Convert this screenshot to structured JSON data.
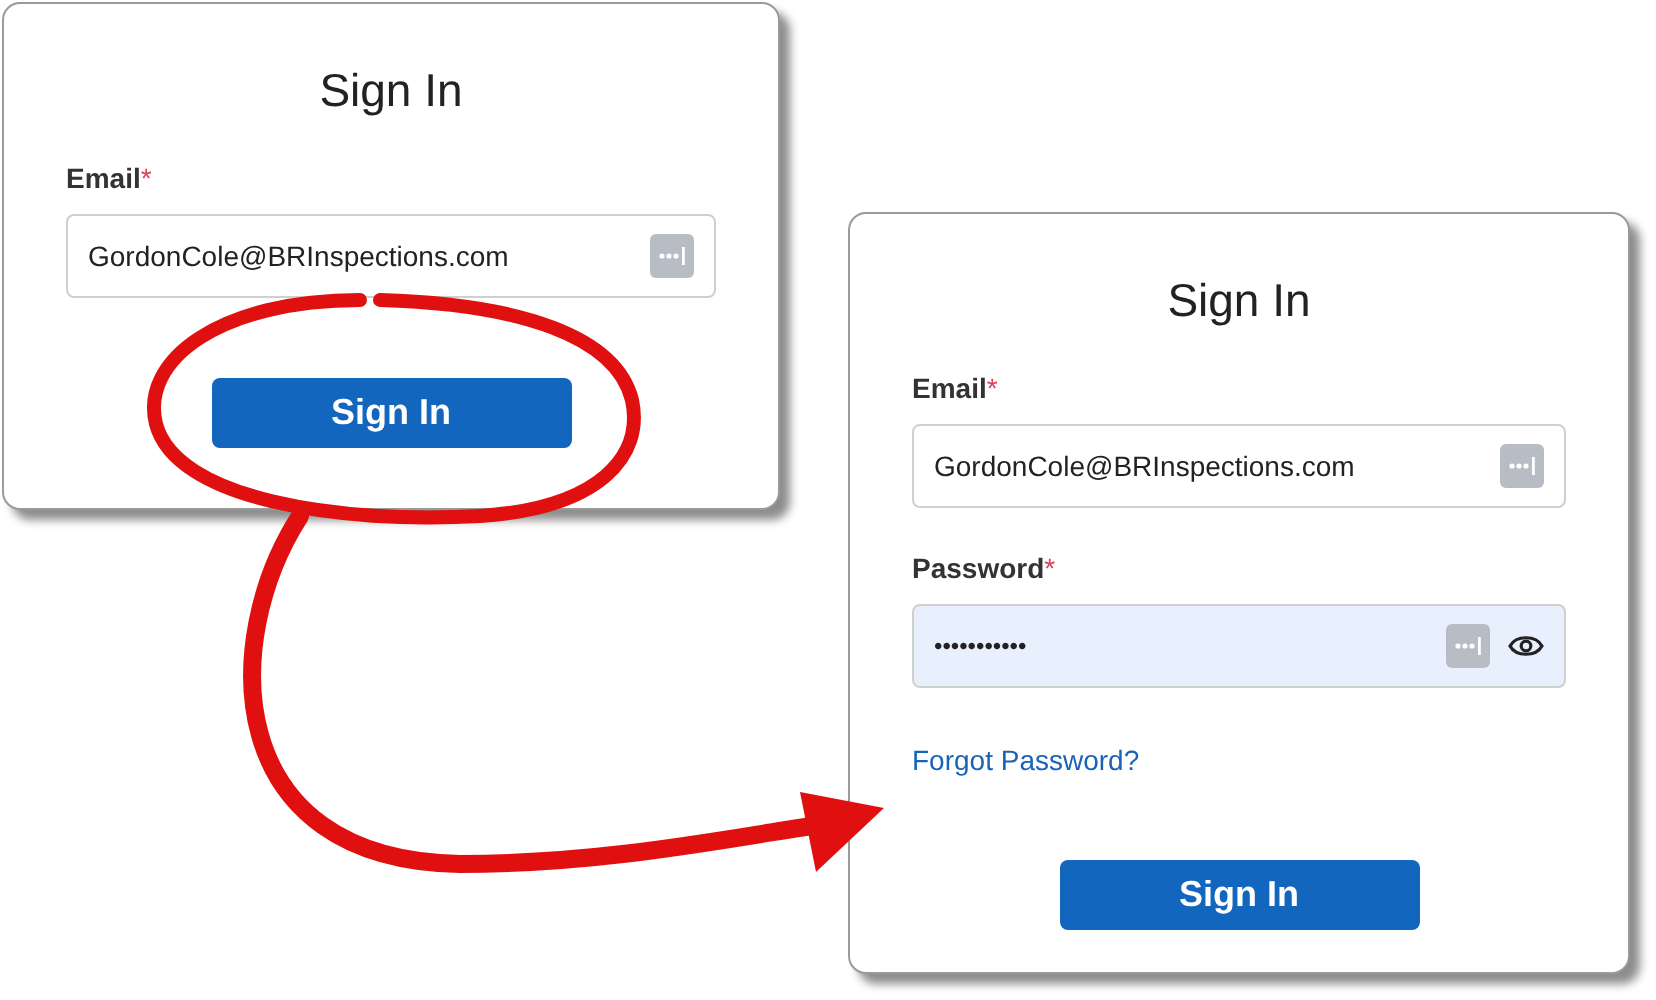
{
  "cards": [
    {
      "title": "Sign In",
      "fields": [
        {
          "kind": "text",
          "label": "Email",
          "required_mark": "*",
          "value": "GordonCole@BRInspections.com",
          "autofilled": false
        }
      ],
      "button": "Sign In"
    },
    {
      "title": "Sign In",
      "fields": [
        {
          "kind": "text",
          "label": "Email",
          "required_mark": "*",
          "value": "GordonCole@BRInspections.com",
          "autofilled": false
        },
        {
          "kind": "password",
          "label": "Password",
          "required_mark": "*",
          "value": "•••••••••••",
          "autofilled": true
        }
      ],
      "link": "Forgot Password?",
      "button": "Sign In"
    }
  ]
}
